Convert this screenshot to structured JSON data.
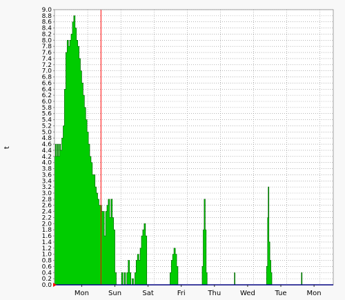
{
  "chart_data": {
    "type": "area",
    "ylabel": "t",
    "xlabel": "",
    "title": "",
    "ylim": [
      0,
      9.0
    ],
    "y_ticks": [
      "0.0",
      "0.2",
      "0.4",
      "0.6",
      "0.8",
      "1.0",
      "1.2",
      "1.4",
      "1.6",
      "1.8",
      "2.0",
      "2.2",
      "2.4",
      "2.6",
      "2.8",
      "3.0",
      "3.2",
      "3.4",
      "3.6",
      "3.8",
      "4.0",
      "4.2",
      "4.4",
      "4.6",
      "4.8",
      "5.0",
      "5.2",
      "5.4",
      "5.6",
      "5.8",
      "6.0",
      "6.2",
      "6.4",
      "6.6",
      "6.8",
      "7.0",
      "7.2",
      "7.4",
      "7.6",
      "7.8",
      "8.0",
      "8.2",
      "8.4",
      "8.6",
      "8.8",
      "9.0"
    ],
    "x_range": [
      0,
      8.4
    ],
    "x_unit": "days elapsed from chart start",
    "day_labels": [
      "Mon",
      "Sun",
      "Sat",
      "Fri",
      "Thu",
      "Wed",
      "Tue",
      "Mon"
    ],
    "day_label_positions": [
      0.82,
      1.82,
      2.82,
      3.82,
      4.82,
      5.82,
      6.82,
      7.82
    ],
    "grid": true,
    "now_marker": 1.4,
    "colors": {
      "background": "#f8f8f8",
      "plot_bg": "#ffffff",
      "fill": "#00cc00",
      "edge": "#006600",
      "grid": "#888888",
      "axis": "#000080",
      "now_line": "#ff0000",
      "origin_marker": "#ff0000"
    },
    "series": [
      {
        "points": [
          [
            0.0,
            4.2
          ],
          [
            0.03,
            4.6
          ],
          [
            0.06,
            4.2
          ],
          [
            0.09,
            4.6
          ],
          [
            0.12,
            4.2
          ],
          [
            0.15,
            4.6
          ],
          [
            0.18,
            4.4
          ],
          [
            0.22,
            4.8
          ],
          [
            0.26,
            5.2
          ],
          [
            0.3,
            6.4
          ],
          [
            0.34,
            7.6
          ],
          [
            0.38,
            8.0
          ],
          [
            0.42,
            7.8
          ],
          [
            0.46,
            8.0
          ],
          [
            0.5,
            8.2
          ],
          [
            0.54,
            8.6
          ],
          [
            0.58,
            8.8
          ],
          [
            0.62,
            8.4
          ],
          [
            0.66,
            8.0
          ],
          [
            0.7,
            7.8
          ],
          [
            0.74,
            7.4
          ],
          [
            0.78,
            7.0
          ],
          [
            0.82,
            6.6
          ],
          [
            0.86,
            6.2
          ],
          [
            0.9,
            5.8
          ],
          [
            0.94,
            5.4
          ],
          [
            0.98,
            5.0
          ],
          [
            1.02,
            4.6
          ],
          [
            1.06,
            4.2
          ],
          [
            1.1,
            4.0
          ],
          [
            1.14,
            3.6
          ],
          [
            1.18,
            3.6
          ],
          [
            1.22,
            3.2
          ],
          [
            1.26,
            3.0
          ],
          [
            1.3,
            2.8
          ],
          [
            1.34,
            2.6
          ],
          [
            1.38,
            2.6
          ],
          [
            1.42,
            2.4
          ],
          [
            1.46,
            2.4
          ],
          [
            1.5,
            1.6
          ],
          [
            1.54,
            2.4
          ],
          [
            1.58,
            2.6
          ],
          [
            1.62,
            2.8
          ],
          [
            1.66,
            2.2
          ],
          [
            1.7,
            2.8
          ],
          [
            1.74,
            2.2
          ],
          [
            1.78,
            1.8
          ],
          [
            1.82,
            0.4
          ],
          [
            1.86,
            0.0
          ],
          [
            1.9,
            0.0
          ],
          [
            1.94,
            0.0
          ],
          [
            1.98,
            0.0
          ],
          [
            2.02,
            0.4
          ],
          [
            2.06,
            0.0
          ],
          [
            2.1,
            0.4
          ],
          [
            2.14,
            0.0
          ],
          [
            2.18,
            0.4
          ],
          [
            2.22,
            0.8
          ],
          [
            2.26,
            0.4
          ],
          [
            2.3,
            0.0
          ],
          [
            2.34,
            0.2
          ],
          [
            2.38,
            0.0
          ],
          [
            2.42,
            0.4
          ],
          [
            2.46,
            0.8
          ],
          [
            2.5,
            1.0
          ],
          [
            2.54,
            0.8
          ],
          [
            2.58,
            1.2
          ],
          [
            2.62,
            1.6
          ],
          [
            2.66,
            1.8
          ],
          [
            2.7,
            2.0
          ],
          [
            2.74,
            1.6
          ],
          [
            2.78,
            0.0
          ],
          [
            2.82,
            0.0
          ],
          [
            3.0,
            0.0
          ],
          [
            3.4,
            0.0
          ],
          [
            3.48,
            0.4
          ],
          [
            3.52,
            0.8
          ],
          [
            3.56,
            1.0
          ],
          [
            3.6,
            1.2
          ],
          [
            3.64,
            1.0
          ],
          [
            3.68,
            0.6
          ],
          [
            3.72,
            0.0
          ],
          [
            4.0,
            0.0
          ],
          [
            4.4,
            0.0
          ],
          [
            4.45,
            0.6
          ],
          [
            4.48,
            1.8
          ],
          [
            4.51,
            2.8
          ],
          [
            4.54,
            1.8
          ],
          [
            4.57,
            0.4
          ],
          [
            4.6,
            0.0
          ],
          [
            5.0,
            0.0
          ],
          [
            5.4,
            0.0
          ],
          [
            5.42,
            0.4
          ],
          [
            5.44,
            0.0
          ],
          [
            6.0,
            0.0
          ],
          [
            6.36,
            0.0
          ],
          [
            6.39,
            0.6
          ],
          [
            6.42,
            2.2
          ],
          [
            6.44,
            3.2
          ],
          [
            6.46,
            1.4
          ],
          [
            6.49,
            0.8
          ],
          [
            6.52,
            0.4
          ],
          [
            6.55,
            0.0
          ],
          [
            7.0,
            0.0
          ],
          [
            7.42,
            0.0
          ],
          [
            7.44,
            0.4
          ],
          [
            7.46,
            0.0
          ],
          [
            8.4,
            0.0
          ]
        ]
      }
    ]
  }
}
